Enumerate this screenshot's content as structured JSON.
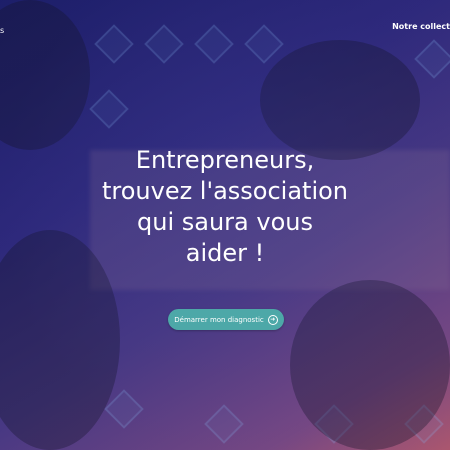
{
  "nav": {
    "left_fragment": "s",
    "right_fragment": "Notre collect"
  },
  "hero": {
    "headline_lines": [
      "Entrepreneurs,",
      "trouvez l'association",
      "qui saura vous",
      "aider !"
    ],
    "cta_label": "Démarrer mon diagnostic",
    "cta_icon": "arrow-right-circle-icon"
  },
  "colors": {
    "cta": "#4da8a8",
    "overlay_top": "#1d1f6b",
    "overlay_bottom": "#b35a70"
  }
}
